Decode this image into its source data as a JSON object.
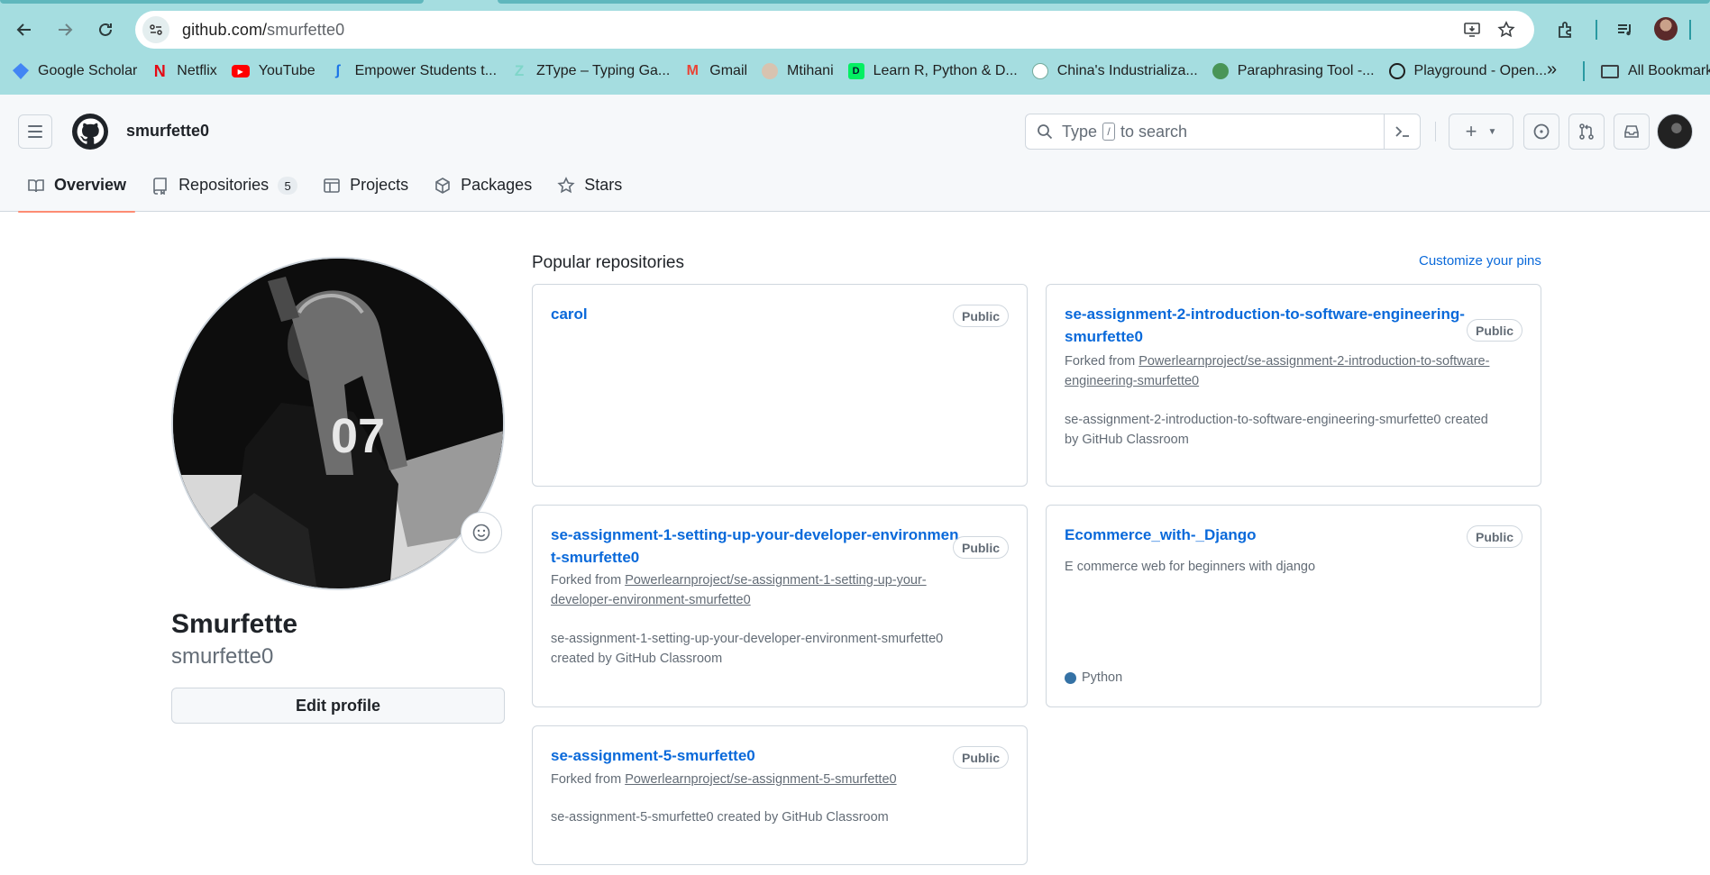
{
  "browser": {
    "url_host": "github.com/",
    "url_path": "smurfette0",
    "bookmarks": [
      {
        "label": "Google Scholar",
        "icon": "google-scholar-icon",
        "color": "#4285f4"
      },
      {
        "label": "Netflix",
        "icon": "netflix-icon",
        "color": "#e50914"
      },
      {
        "label": "YouTube",
        "icon": "youtube-icon",
        "color": "#ff0000"
      },
      {
        "label": "Empower Students t...",
        "icon": "empower-icon",
        "color": "#1a73e8"
      },
      {
        "label": "ZType – Typing Ga...",
        "icon": "ztype-icon",
        "color": "#7fd6c9"
      },
      {
        "label": "Gmail",
        "icon": "gmail-icon",
        "color": "#ea4335"
      },
      {
        "label": "Mtihani",
        "icon": "mtihani-icon",
        "color": "#7a5230"
      },
      {
        "label": "Learn R, Python & D...",
        "icon": "datacamp-icon",
        "color": "#03ef62"
      },
      {
        "label": "China's Industrializa...",
        "icon": "chatgpt-icon",
        "color": "#74aa9c"
      },
      {
        "label": "Paraphrasing Tool -...",
        "icon": "quillbot-icon",
        "color": "#499557"
      },
      {
        "label": "Playground - Open...",
        "icon": "openai-icon",
        "color": "#1f1f1f"
      }
    ],
    "all_bookmarks": "All Bookmarks"
  },
  "header": {
    "username": "smurfette0",
    "search_prefix": "Type",
    "search_key": "/",
    "search_suffix": "to search"
  },
  "tabs": [
    {
      "label": "Overview",
      "icon": "book-icon",
      "active": true
    },
    {
      "label": "Repositories",
      "icon": "repo-icon",
      "count": "5"
    },
    {
      "label": "Projects",
      "icon": "table-icon"
    },
    {
      "label": "Packages",
      "icon": "package-icon"
    },
    {
      "label": "Stars",
      "icon": "star-icon"
    }
  ],
  "profile": {
    "display_name": "Smurfette",
    "login": "smurfette0",
    "edit_button": "Edit profile"
  },
  "pinned": {
    "title": "Popular repositories",
    "customize": "Customize your pins",
    "repos": [
      {
        "name": "carol",
        "visibility": "Public"
      },
      {
        "name_line1": "se-assignment-2-introduction-to-software-engineering-",
        "name_line2": "smurfette0",
        "visibility": "Public",
        "fork_prefix": "Forked from ",
        "fork_line1": "Powerlearnproject/se-assignment-2-introduction-to-software-",
        "fork_line2": "engineering-smurfette0",
        "desc_line1": "se-assignment-2-introduction-to-software-engineering-smurfette0 created",
        "desc_line2": "by GitHub Classroom"
      },
      {
        "name_line1": "se-assignment-1-setting-up-your-developer-environmen",
        "name_line2": "t-smurfette0",
        "visibility": "Public",
        "fork_prefix": "Forked from ",
        "fork_line1": "Powerlearnproject/se-assignment-1-setting-up-your-",
        "fork_line2": "developer-environment-smurfette0",
        "desc_line1": "se-assignment-1-setting-up-your-developer-environment-smurfette0",
        "desc_line2": "created by GitHub Classroom"
      },
      {
        "name": "Ecommerce_with-_Django",
        "visibility": "Public",
        "desc": "E commerce web for beginners with django",
        "language": "Python",
        "language_color": "#3572a5"
      },
      {
        "name": "se-assignment-5-smurfette0",
        "visibility": "Public",
        "fork_prefix": "Forked from ",
        "fork_link": "Powerlearnproject/se-assignment-5-smurfette0",
        "desc": "se-assignment-5-smurfette0 created by GitHub Classroom"
      }
    ]
  }
}
